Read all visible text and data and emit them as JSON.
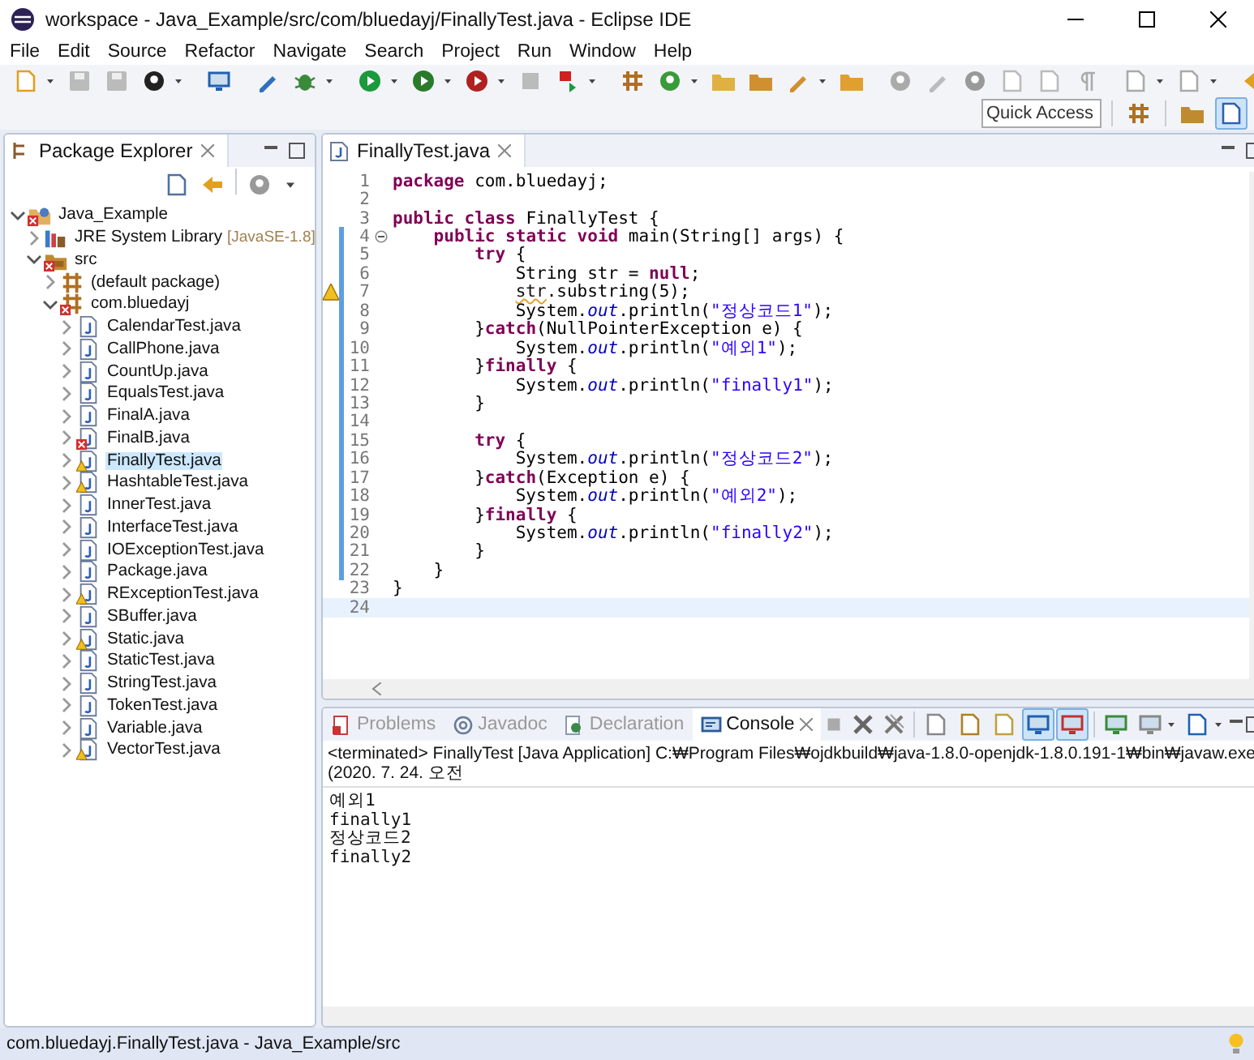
{
  "window": {
    "title": "workspace - Java_Example/src/com/bluedayj/FinallyTest.java - Eclipse IDE"
  },
  "menu": [
    "File",
    "Edit",
    "Source",
    "Refactor",
    "Navigate",
    "Search",
    "Project",
    "Run",
    "Window",
    "Help"
  ],
  "quick_access": {
    "placeholder": "Quick Access"
  },
  "package_explorer": {
    "title": "Package Explorer",
    "tree": [
      {
        "label": "Java_Example",
        "kind": "project",
        "error": true,
        "warning": false,
        "expanded": true,
        "selected": false,
        "children": [
          {
            "label": "JRE System Library",
            "suffix": "[JavaSE-1.8]",
            "kind": "library",
            "error": false,
            "warning": false,
            "expanded": false,
            "selected": false
          },
          {
            "label": "src",
            "kind": "folder",
            "error": true,
            "warning": false,
            "expanded": true,
            "selected": false,
            "children": [
              {
                "label": "(default package)",
                "kind": "package",
                "error": false,
                "warning": false,
                "expanded": false,
                "selected": false
              },
              {
                "label": "com.bluedayj",
                "kind": "package",
                "error": true,
                "warning": false,
                "expanded": true,
                "selected": false,
                "children": [
                  {
                    "label": "CalendarTest.java",
                    "kind": "file",
                    "error": false,
                    "warning": false,
                    "expanded": false,
                    "selected": false
                  },
                  {
                    "label": "CallPhone.java",
                    "kind": "file",
                    "error": false,
                    "warning": false,
                    "expanded": false,
                    "selected": false
                  },
                  {
                    "label": "CountUp.java",
                    "kind": "file",
                    "error": false,
                    "warning": false,
                    "expanded": false,
                    "selected": false
                  },
                  {
                    "label": "EqualsTest.java",
                    "kind": "file",
                    "error": false,
                    "warning": false,
                    "expanded": false,
                    "selected": false
                  },
                  {
                    "label": "FinalA.java",
                    "kind": "file",
                    "error": false,
                    "warning": false,
                    "expanded": false,
                    "selected": false
                  },
                  {
                    "label": "FinalB.java",
                    "kind": "file",
                    "error": true,
                    "warning": false,
                    "expanded": false,
                    "selected": false
                  },
                  {
                    "label": "FinallyTest.java",
                    "kind": "file",
                    "error": false,
                    "warning": true,
                    "expanded": false,
                    "selected": true
                  },
                  {
                    "label": "HashtableTest.java",
                    "kind": "file",
                    "error": false,
                    "warning": true,
                    "expanded": false,
                    "selected": false
                  },
                  {
                    "label": "InnerTest.java",
                    "kind": "file",
                    "error": false,
                    "warning": false,
                    "expanded": false,
                    "selected": false
                  },
                  {
                    "label": "InterfaceTest.java",
                    "kind": "file",
                    "error": false,
                    "warning": false,
                    "expanded": false,
                    "selected": false
                  },
                  {
                    "label": "IOExceptionTest.java",
                    "kind": "file",
                    "error": false,
                    "warning": false,
                    "expanded": false,
                    "selected": false
                  },
                  {
                    "label": "Package.java",
                    "kind": "file",
                    "error": false,
                    "warning": false,
                    "expanded": false,
                    "selected": false
                  },
                  {
                    "label": "RExceptionTest.java",
                    "kind": "file",
                    "error": false,
                    "warning": true,
                    "expanded": false,
                    "selected": false
                  },
                  {
                    "label": "SBuffer.java",
                    "kind": "file",
                    "error": false,
                    "warning": false,
                    "expanded": false,
                    "selected": false
                  },
                  {
                    "label": "Static.java",
                    "kind": "file",
                    "error": false,
                    "warning": true,
                    "expanded": false,
                    "selected": false
                  },
                  {
                    "label": "StaticTest.java",
                    "kind": "file",
                    "error": false,
                    "warning": false,
                    "expanded": false,
                    "selected": false
                  },
                  {
                    "label": "StringTest.java",
                    "kind": "file",
                    "error": false,
                    "warning": false,
                    "expanded": false,
                    "selected": false
                  },
                  {
                    "label": "TokenTest.java",
                    "kind": "file",
                    "error": false,
                    "warning": false,
                    "expanded": false,
                    "selected": false
                  },
                  {
                    "label": "Variable.java",
                    "kind": "file",
                    "error": false,
                    "warning": false,
                    "expanded": false,
                    "selected": false
                  },
                  {
                    "label": "VectorTest.java",
                    "kind": "file",
                    "error": false,
                    "warning": true,
                    "expanded": false,
                    "selected": false
                  }
                ]
              }
            ]
          }
        ]
      }
    ]
  },
  "editor": {
    "tab": "FinallyTest.java",
    "lines": [
      {
        "number": "1",
        "tokens": [
          {
            "kind": "keyword",
            "text": "package"
          },
          {
            "kind": "plain",
            "text": " com.bluedayj;"
          }
        ]
      },
      {
        "number": "2"
      },
      {
        "number": "3",
        "tokens": [
          {
            "kind": "keyword",
            "text": "public class"
          },
          {
            "kind": "plain",
            "text": " FinallyTest {"
          }
        ]
      },
      {
        "number": "4",
        "fold": true,
        "scope": true,
        "tokens": [
          {
            "kind": "keyword",
            "text": "    public static void"
          },
          {
            "kind": "plain",
            "text": " main(String[] args) {"
          }
        ]
      },
      {
        "number": "5",
        "scope": true,
        "tokens": [
          {
            "kind": "keyword",
            "text": "        try"
          },
          {
            "kind": "plain",
            "text": " {"
          }
        ]
      },
      {
        "number": "6",
        "scope": true,
        "tokens": [
          {
            "kind": "plain",
            "text": "            String str = "
          },
          {
            "kind": "keyword",
            "text": "null"
          },
          {
            "kind": "plain",
            "text": ";"
          }
        ]
      },
      {
        "number": "7",
        "scope": true,
        "warning": true,
        "tokens": [
          {
            "kind": "warning",
            "text": "            str"
          },
          {
            "kind": "plain",
            "text": ".substring(5);"
          }
        ]
      },
      {
        "number": "8",
        "scope": true,
        "tokens": [
          {
            "kind": "plain",
            "text": "            System."
          },
          {
            "kind": "field",
            "text": "out"
          },
          {
            "kind": "plain",
            "text": ".println("
          },
          {
            "kind": "string",
            "text": "\"정상코드1\""
          },
          {
            "kind": "plain",
            "text": ");"
          }
        ]
      },
      {
        "number": "9",
        "scope": true,
        "tokens": [
          {
            "kind": "plain",
            "text": "        }"
          },
          {
            "kind": "keyword",
            "text": "catch"
          },
          {
            "kind": "plain",
            "text": "(NullPointerException e) {"
          }
        ]
      },
      {
        "number": "10",
        "scope": true,
        "tokens": [
          {
            "kind": "plain",
            "text": "            System."
          },
          {
            "kind": "field",
            "text": "out"
          },
          {
            "kind": "plain",
            "text": ".println("
          },
          {
            "kind": "string",
            "text": "\"예외1\""
          },
          {
            "kind": "plain",
            "text": ");"
          }
        ]
      },
      {
        "number": "11",
        "scope": true,
        "tokens": [
          {
            "kind": "plain",
            "text": "        }"
          },
          {
            "kind": "keyword",
            "text": "finally"
          },
          {
            "kind": "plain",
            "text": " {"
          }
        ]
      },
      {
        "number": "12",
        "scope": true,
        "tokens": [
          {
            "kind": "plain",
            "text": "            System."
          },
          {
            "kind": "field",
            "text": "out"
          },
          {
            "kind": "plain",
            "text": ".println("
          },
          {
            "kind": "string",
            "text": "\"finally1\""
          },
          {
            "kind": "plain",
            "text": ");"
          }
        ]
      },
      {
        "number": "13",
        "scope": true,
        "tokens": [
          {
            "kind": "plain",
            "text": "        }"
          }
        ]
      },
      {
        "number": "14",
        "scope": true
      },
      {
        "number": "15",
        "scope": true,
        "tokens": [
          {
            "kind": "keyword",
            "text": "        try"
          },
          {
            "kind": "plain",
            "text": " {"
          }
        ]
      },
      {
        "number": "16",
        "scope": true,
        "tokens": [
          {
            "kind": "plain",
            "text": "            System."
          },
          {
            "kind": "field",
            "text": "out"
          },
          {
            "kind": "plain",
            "text": ".println("
          },
          {
            "kind": "string",
            "text": "\"정상코드2\""
          },
          {
            "kind": "plain",
            "text": ");"
          }
        ]
      },
      {
        "number": "17",
        "scope": true,
        "tokens": [
          {
            "kind": "plain",
            "text": "        }"
          },
          {
            "kind": "keyword",
            "text": "catch"
          },
          {
            "kind": "plain",
            "text": "(Exception e) {"
          }
        ]
      },
      {
        "number": "18",
        "scope": true,
        "tokens": [
          {
            "kind": "plain",
            "text": "            System."
          },
          {
            "kind": "field",
            "text": "out"
          },
          {
            "kind": "plain",
            "text": ".println("
          },
          {
            "kind": "string",
            "text": "\"예외2\""
          },
          {
            "kind": "plain",
            "text": ");"
          }
        ]
      },
      {
        "number": "19",
        "scope": true,
        "tokens": [
          {
            "kind": "plain",
            "text": "        }"
          },
          {
            "kind": "keyword",
            "text": "finally"
          },
          {
            "kind": "plain",
            "text": " {"
          }
        ]
      },
      {
        "number": "20",
        "scope": true,
        "tokens": [
          {
            "kind": "plain",
            "text": "            System."
          },
          {
            "kind": "field",
            "text": "out"
          },
          {
            "kind": "plain",
            "text": ".println("
          },
          {
            "kind": "string",
            "text": "\"finally2\""
          },
          {
            "kind": "plain",
            "text": ");"
          }
        ]
      },
      {
        "number": "21",
        "scope": true,
        "tokens": [
          {
            "kind": "plain",
            "text": "        }"
          }
        ]
      },
      {
        "number": "22",
        "scope": true,
        "tokens": [
          {
            "kind": "plain",
            "text": "    }"
          }
        ]
      },
      {
        "number": "23",
        "tokens": [
          {
            "kind": "plain",
            "text": "}"
          }
        ]
      },
      {
        "number": "24",
        "current": true
      }
    ]
  },
  "bottom_panel": {
    "tabs": [
      {
        "label": "Problems",
        "kind": "problems",
        "selected": false
      },
      {
        "label": "Javadoc",
        "kind": "javadoc",
        "selected": false
      },
      {
        "label": "Declaration",
        "kind": "declaration",
        "selected": false
      },
      {
        "label": "Console",
        "kind": "console",
        "selected": true
      }
    ],
    "header": "<terminated> FinallyTest [Java Application] C:₩Program Files₩ojdkbuild₩java-1.8.0-openjdk-1.8.0.191-1₩bin₩javaw.exe (2020. 7. 24. 오전",
    "output": [
      "예외1",
      "finally1",
      "정상코드2",
      "finally2"
    ]
  },
  "status_bar": {
    "text": "com.bluedayj.FinallyTest.java - Java_Example/src"
  }
}
